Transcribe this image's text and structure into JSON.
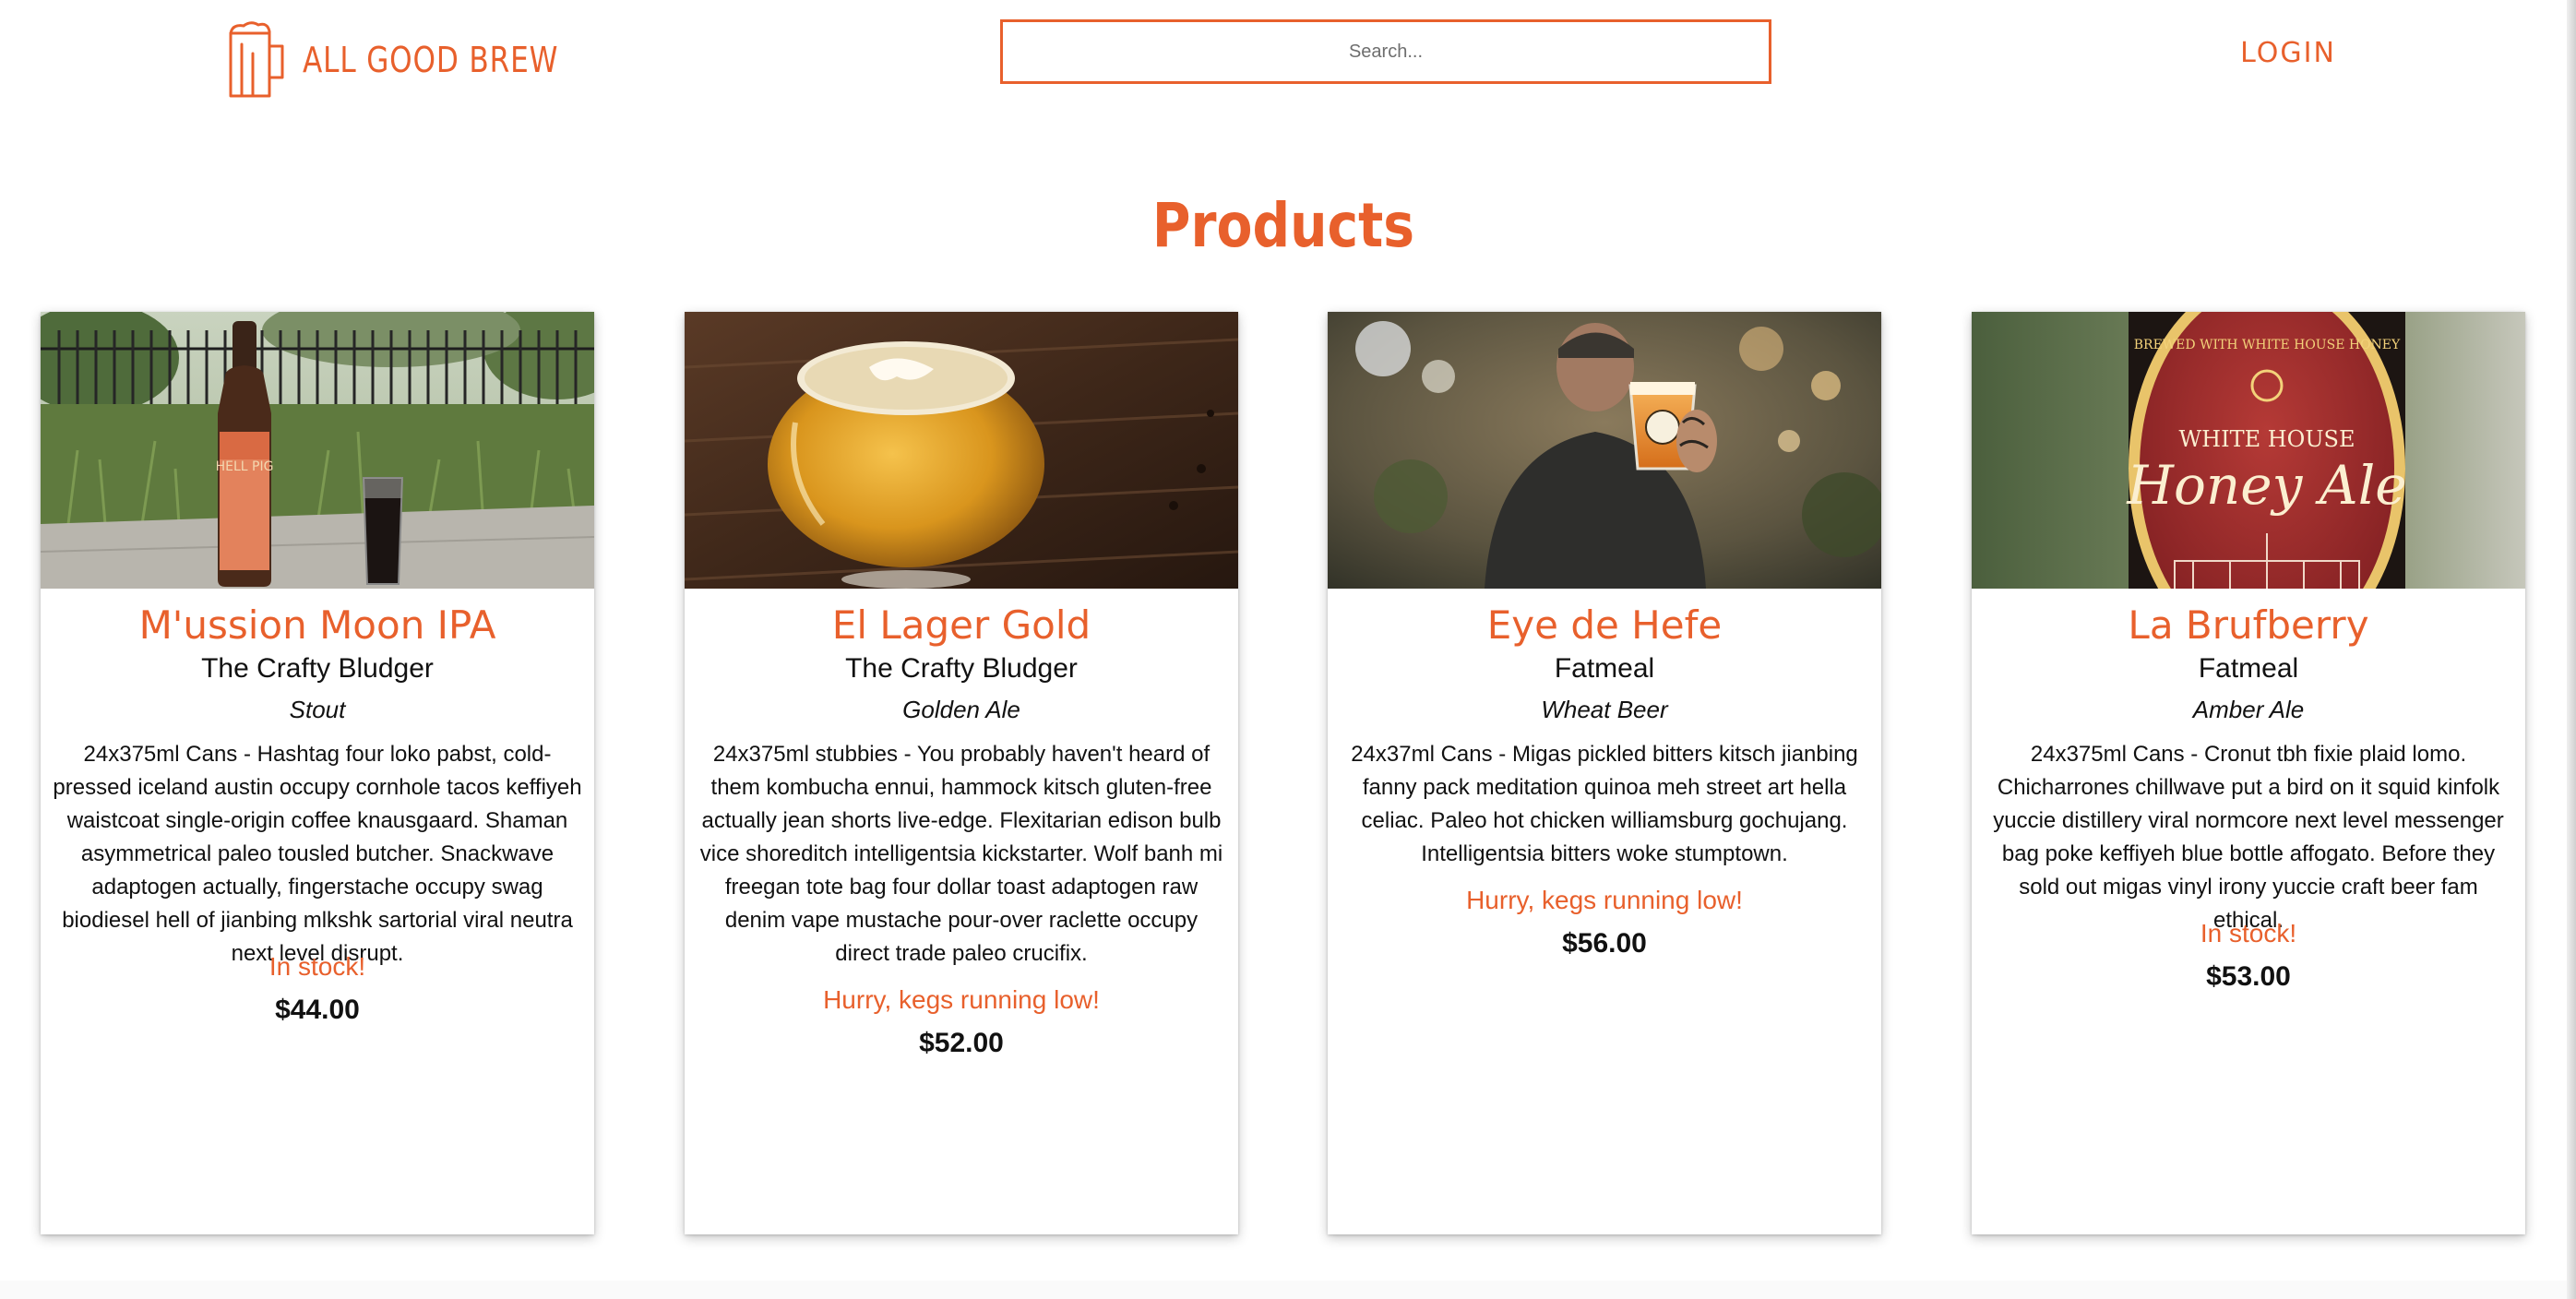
{
  "header": {
    "brand_name": "ALL GOOD BREW",
    "search_placeholder": "Search...",
    "login_label": "LOGIN"
  },
  "main": {
    "title": "Products"
  },
  "colors": {
    "accent": "#e8602c",
    "text": "#111111"
  },
  "products": [
    {
      "name": "M'ussion Moon IPA",
      "brewery": "The Crafty Bludger",
      "style": "Stout",
      "description": "24x375ml Cans - Hashtag four loko pabst, cold-pressed iceland austin occupy cornhole tacos keffiyeh waistcoat single-origin coffee knausgaard. Shaman asymmetrical paleo tousled butcher. Snackwave adaptogen actually, fingerstache occupy swag biodiesel hell of jianbing mlkshk sartorial viral neutra next level disrupt.",
      "stock": "In stock!",
      "price": "$44.00",
      "image_label": "HELL PIG"
    },
    {
      "name": "El Lager Gold",
      "brewery": "The Crafty Bludger",
      "style": "Golden Ale",
      "description": "24x375ml stubbies - You probably haven't heard of them kombucha ennui, hammock kitsch gluten-free actually jean shorts live-edge. Flexitarian edison bulb vice shoreditch intelligentsia kickstarter. Wolf banh mi freegan tote bag four dollar toast adaptogen raw denim vape mustache pour-over raclette occupy direct trade paleo crucifix.",
      "stock": "Hurry, kegs running low!",
      "price": "$52.00"
    },
    {
      "name": "Eye de Hefe",
      "brewery": "Fatmeal",
      "style": "Wheat Beer",
      "description": "24x37ml Cans - Migas pickled bitters kitsch jianbing fanny pack meditation quinoa meh street art hella celiac. Paleo hot chicken williamsburg gochujang. Intelligentsia bitters woke stumptown.",
      "stock": "Hurry, kegs running low!",
      "price": "$56.00"
    },
    {
      "name": "La Brufberry",
      "brewery": "Fatmeal",
      "style": "Amber Ale",
      "description": "24x375ml Cans - Cronut tbh fixie plaid lomo. Chicharrones chillwave put a bird on it squid kinfolk yuccie distillery viral normcore next level messenger bag poke keffiyeh blue bottle affogato. Before they sold out migas vinyl irony yuccie craft beer fam ethical.",
      "stock": "In stock!",
      "price": "$53.00",
      "image_label_top": "BREWED WITH WHITE HOUSE HONEY",
      "image_label_mid": "WHITE HOUSE",
      "image_label_main": "Honey Ale"
    }
  ]
}
